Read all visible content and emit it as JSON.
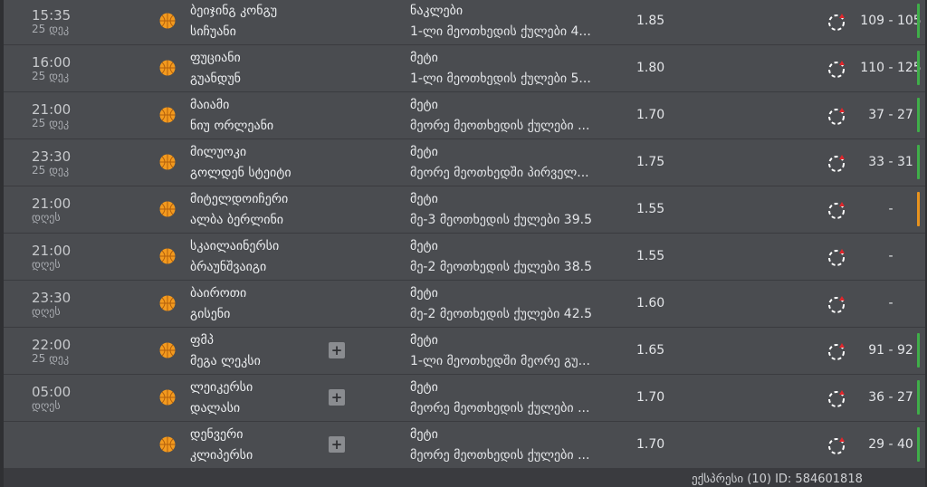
{
  "bets": [
    {
      "time": "15:35",
      "date": "25 დეკ",
      "team1": "ბეიჯინგ კონგუ",
      "team2": "სიჩუანი",
      "market": "ნაკლები",
      "selection": "1-ლი მეოთხედის ქულები 4...",
      "odds": "1.85",
      "score": "109 - 105",
      "bar": "#3fae49",
      "plus": false
    },
    {
      "time": "16:00",
      "date": "25 დეკ",
      "team1": "ფუციანი",
      "team2": "გუანდუნ",
      "market": "მეტი",
      "selection": "1-ლი მეოთხედის ქულები 5...",
      "odds": "1.80",
      "score": "110 - 125",
      "bar": "#3fae49",
      "plus": false
    },
    {
      "time": "21:00",
      "date": "25 დეკ",
      "team1": "მაიამი",
      "team2": "ნიუ ორლეანი",
      "market": "მეტი",
      "selection": "მეორე მეოთხედის ქულები ...",
      "odds": "1.70",
      "score": "37 - 27",
      "bar": "#3fae49",
      "plus": false
    },
    {
      "time": "23:30",
      "date": "25 დეკ",
      "team1": "მილუოკი",
      "team2": "გოლდენ სტეიტი",
      "market": "მეტი",
      "selection": "მეორე მეოთხედში პირველ...",
      "odds": "1.75",
      "score": "33 - 31",
      "bar": "#3fae49",
      "plus": false
    },
    {
      "time": "21:00",
      "date": "დღეს",
      "team1": "მიტელდოიჩერი",
      "team2": "ალბა ბერლინი",
      "market": "მეტი",
      "selection": "მე-3 მეოთხედის ქულები 39.5",
      "odds": "1.55",
      "score": "-",
      "bar": "#e8931e",
      "plus": false
    },
    {
      "time": "21:00",
      "date": "დღეს",
      "team1": "სკაილაინერსი",
      "team2": "ბრაუნშვაიგი",
      "market": "მეტი",
      "selection": "მე-2 მეოთხედის ქულები 38.5",
      "odds": "1.55",
      "score": "-",
      "bar": "",
      "plus": false
    },
    {
      "time": "23:30",
      "date": "დღეს",
      "team1": "ბაიროთი",
      "team2": "გისენი",
      "market": "მეტი",
      "selection": "მე-2 მეოთხედის ქულები 42.5",
      "odds": "1.60",
      "score": "-",
      "bar": "",
      "plus": false
    },
    {
      "time": "22:00",
      "date": "25 დეკ",
      "team1": "ფმპ",
      "team2": "მეგა ლეკსი",
      "market": "მეტი",
      "selection": "1-ლი მეოთხედში მეორე გუ...",
      "odds": "1.65",
      "score": "91 - 92",
      "bar": "#3fae49",
      "plus": true
    },
    {
      "time": "05:00",
      "date": "დღეს",
      "team1": "ლეიკერსი",
      "team2": "დალასი",
      "market": "მეტი",
      "selection": "მეორე მეოთხედის ქულები ...",
      "odds": "1.70",
      "score": "36 - 27",
      "bar": "#3fae49",
      "plus": true
    },
    {
      "time": "",
      "date": "",
      "team1": "დენვერი",
      "team2": "კლიპერსი",
      "market": "მეტი",
      "selection": "მეორე მეოთხედის ქულები ...",
      "odds": "1.70",
      "score": "29 - 40",
      "bar": "#3fae49",
      "plus": true
    }
  ],
  "footer": "ექსპრესი (10)     ID: 584601818",
  "icons": {
    "sport": "basketball-icon",
    "status": "live-status-icon",
    "expand": "plus-icon"
  }
}
